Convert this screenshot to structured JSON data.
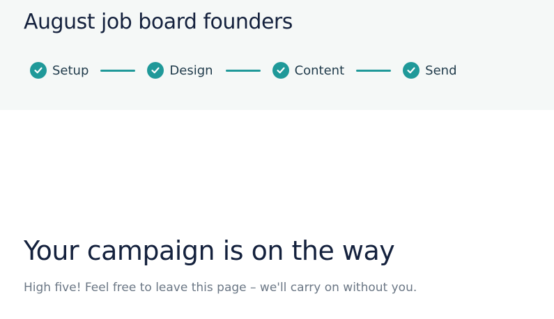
{
  "colors": {
    "accent": "#1f9999",
    "header_bg": "#f5f8f7",
    "heading_text": "#14213d",
    "muted_text": "#6b7785"
  },
  "campaign": {
    "title": "August job board founders"
  },
  "steps": [
    {
      "label": "Setup",
      "icon": "check-circle-icon",
      "completed": true
    },
    {
      "label": "Design",
      "icon": "check-circle-icon",
      "completed": true
    },
    {
      "label": "Content",
      "icon": "check-circle-icon",
      "completed": true
    },
    {
      "label": "Send",
      "icon": "check-circle-icon",
      "completed": true
    }
  ],
  "status": {
    "heading": "Your campaign is on the way",
    "subtext": "High five! Feel free to leave this page – we'll carry on without you."
  }
}
